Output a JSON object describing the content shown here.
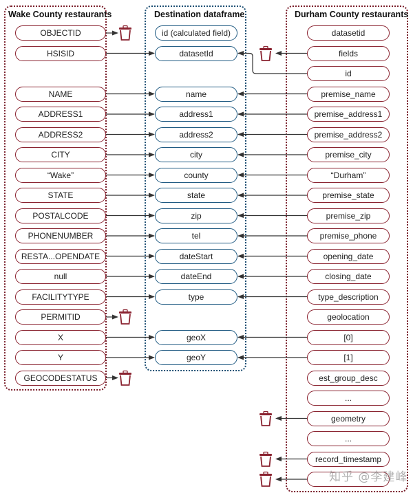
{
  "groups": {
    "wake": {
      "title": "Wake County restaurants"
    },
    "destination": {
      "title": "Destination dataframe"
    },
    "durham": {
      "title": "Durham County restaurants"
    }
  },
  "wake_fields": [
    "OBJECTID",
    "HSISID",
    "NAME",
    "ADDRESS1",
    "ADDRESS2",
    "CITY",
    "“Wake”",
    "STATE",
    "POSTALCODE",
    "PHONENUMBER",
    "RESTA...OPENDATE",
    "null",
    "FACILITYTYPE",
    "PERMITID",
    "X",
    "Y",
    "GEOCODESTATUS"
  ],
  "destination_fields": [
    "id (calculated field)",
    "datasetId",
    "name",
    "address1",
    "address2",
    "city",
    "county",
    "state",
    "zip",
    "tel",
    "dateStart",
    "dateEnd",
    "type",
    "geoX",
    "geoY"
  ],
  "durham_fields": [
    "datasetid",
    "fields",
    "id",
    "premise_name",
    "premise_address1",
    "premise_address2",
    "premise_city",
    "“Durham”",
    "premise_state",
    "premise_zip",
    "premise_phone",
    "opening_date",
    "closing_date",
    "type_description",
    "geolocation",
    "[0]",
    "[1]",
    "est_group_desc",
    "...",
    "geometry",
    "...",
    "record_timestamp",
    ""
  ],
  "mappings": {
    "wake_to_destination": [
      [
        "HSISID",
        "datasetId"
      ],
      [
        "NAME",
        "name"
      ],
      [
        "ADDRESS1",
        "address1"
      ],
      [
        "ADDRESS2",
        "address2"
      ],
      [
        "CITY",
        "city"
      ],
      [
        "“Wake”",
        "county"
      ],
      [
        "STATE",
        "state"
      ],
      [
        "POSTALCODE",
        "zip"
      ],
      [
        "PHONENUMBER",
        "tel"
      ],
      [
        "RESTA...OPENDATE",
        "dateStart"
      ],
      [
        "null",
        "dateEnd"
      ],
      [
        "FACILITYTYPE",
        "type"
      ],
      [
        "X",
        "geoX"
      ],
      [
        "Y",
        "geoY"
      ]
    ],
    "wake_discarded": [
      "OBJECTID",
      "PERMITID",
      "GEOCODESTATUS"
    ],
    "durham_to_destination": [
      [
        "id",
        "datasetId"
      ],
      [
        "premise_name",
        "name"
      ],
      [
        "premise_address1",
        "address1"
      ],
      [
        "premise_address2",
        "address2"
      ],
      [
        "premise_city",
        "city"
      ],
      [
        "“Durham”",
        "county"
      ],
      [
        "premise_state",
        "state"
      ],
      [
        "premise_zip",
        "zip"
      ],
      [
        "premise_phone",
        "tel"
      ],
      [
        "opening_date",
        "dateStart"
      ],
      [
        "closing_date",
        "dateEnd"
      ],
      [
        "type_description",
        "type"
      ],
      [
        "[0]",
        "geoX"
      ],
      [
        "[1]",
        "geoY"
      ]
    ],
    "durham_discarded": [
      "fields",
      "geometry",
      "record_timestamp",
      ""
    ]
  },
  "icons": {
    "discard": "trash-icon"
  },
  "colors": {
    "source": "#8a2330",
    "destination": "#1f5a82",
    "connector": "#333333"
  },
  "watermark": "知乎 @李建峰"
}
